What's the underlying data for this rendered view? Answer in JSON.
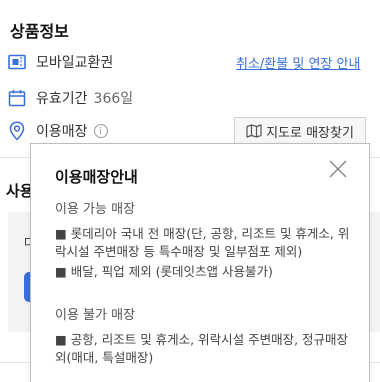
{
  "product_info": {
    "title": "상품정보",
    "voucher_label": "모바일교환권",
    "refund_link": "취소/환불 및 연장 안내",
    "validity_label": "유효기간",
    "validity_value": "366일",
    "store_label": "이용매장",
    "info_symbol": "i",
    "map_button": "지도로 매장찾기"
  },
  "background": {
    "section_heading": "사용",
    "card_letter": "다"
  },
  "store_popup": {
    "title": "이용매장안내",
    "available_heading": "이용 가능 매장",
    "available_items": [
      "■ 롯데리아 국내 전 매장(단, 공항, 리조트 및 휴게소, 위락시설 주변매장 등 특수매장 및 일부점포 제외)",
      "■ 배달, 픽업 제외 (롯데잇츠앱 사용불가)"
    ],
    "unavailable_heading": "이용 불가 매장",
    "unavailable_items": [
      "■ 공항, 리조트 및 휴게소, 위락시설 주변매장, 정규매장 외(매대, 특설매장)"
    ]
  },
  "colors": {
    "link_blue": "#3a6fd8",
    "icon_blue": "#3a6fd8"
  },
  "icons": {
    "voucher": "mobile-voucher-icon",
    "calendar": "calendar-icon",
    "location": "location-pin-icon",
    "map": "map-icon",
    "close": "close-icon"
  }
}
